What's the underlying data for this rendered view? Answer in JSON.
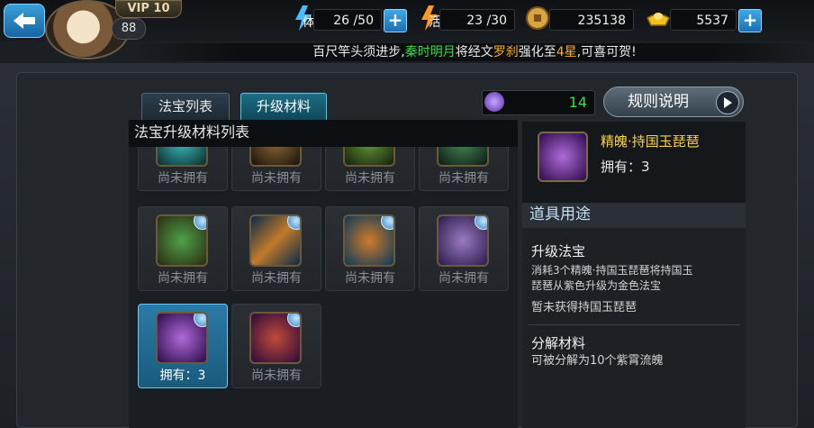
{
  "hud": {
    "vip_label": "VIP 10",
    "level": "88",
    "stamina": {
      "label": "体",
      "value": "26 /50"
    },
    "vigor": {
      "label": "活",
      "value": "23 /30"
    },
    "coins": {
      "value": "235138"
    },
    "gold": {
      "value": "5537"
    },
    "plus_symbol": "+"
  },
  "broadcast": {
    "part1": "百尺竿头须进步,",
    "player": "秦时明月",
    "part2": "将经文",
    "item": "罗刹",
    "part3": "强化至",
    "stars": "4星",
    "part4": ",可喜可贺!"
  },
  "tabs": [
    {
      "label": "法宝列表",
      "active": false
    },
    {
      "label": "升级材料",
      "active": true
    }
  ],
  "currency": {
    "value": "14"
  },
  "rules_button": {
    "label": "规则说明"
  },
  "list": {
    "title": "法宝升级材料列表",
    "items": [
      {
        "status": "尚未拥有",
        "icon": "material-cyan-icon"
      },
      {
        "status": "尚未拥有",
        "icon": "material-fan-icon"
      },
      {
        "status": "尚未拥有",
        "icon": "material-green-icon"
      },
      {
        "status": "尚未拥有",
        "icon": "material-claw-icon"
      },
      {
        "status": "尚未拥有",
        "icon": "jade-statue-icon"
      },
      {
        "status": "尚未拥有",
        "icon": "sword-icon"
      },
      {
        "status": "尚未拥有",
        "icon": "crown-icon"
      },
      {
        "status": "尚未拥有",
        "icon": "banner-icon"
      },
      {
        "status": "拥有：3",
        "icon": "pipa-icon",
        "selected": true
      },
      {
        "status": "尚未拥有",
        "icon": "demon-mask-icon"
      }
    ]
  },
  "detail": {
    "name": "精魄·持国玉琵琶",
    "owned": "拥有：3",
    "usage_title": "道具用途",
    "sections": [
      {
        "title": "升级法宝",
        "desc_lines": [
          "消耗3个精魄·持国玉琵琶将持国玉",
          "琵琶从紫色升级为金色法宝"
        ],
        "note": "暂未获得持国玉琵琶"
      },
      {
        "title": "分解材料",
        "desc_lines": [
          "可被分解为10个紫霄流魄"
        ]
      }
    ]
  },
  "colors": {
    "accent": "#3ddc49",
    "highlight": "#ffb020",
    "name": "#ffd24a"
  }
}
